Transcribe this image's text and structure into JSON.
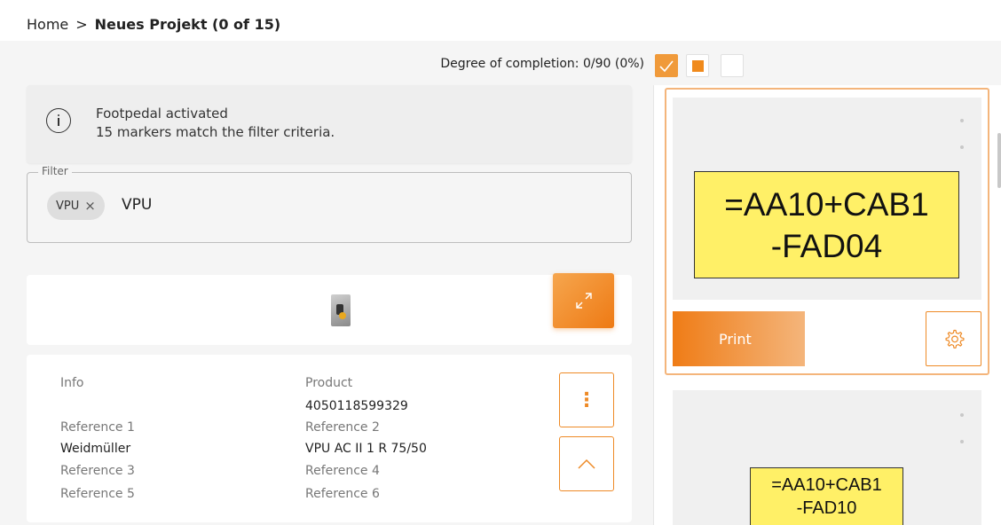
{
  "breadcrumb": {
    "home": "Home",
    "separator": ">",
    "current": "Neues Projekt (0 of 15)"
  },
  "completion": {
    "text": "Degree of completion: 0/90 (0%)"
  },
  "view_buttons": [
    "check-view",
    "square-view",
    "blank-view"
  ],
  "notice": {
    "line1": "Footpedal activated",
    "line2": "15 markers match the filter criteria."
  },
  "filter": {
    "label": "Filter",
    "chip": "VPU",
    "value": "VPU"
  },
  "details": {
    "info_label": "Info",
    "product_label": "Product",
    "product_value": "4050118599329",
    "ref1_label": "Reference 1",
    "ref1_value": "Weidmüller",
    "ref2_label": "Reference 2",
    "ref2_value": "VPU AC II 1 R 75/50",
    "ref3_label": "Reference 3",
    "ref4_label": "Reference 4",
    "ref5_label": "Reference 5",
    "ref6_label": "Reference 6"
  },
  "markers": [
    {
      "line1": "=AA10+CAB1",
      "line2": "-FAD04"
    },
    {
      "line1": "=AA10+CAB1",
      "line2": "-FAD10"
    }
  ],
  "print_label": "Print",
  "colors": {
    "accent": "#ee8a26",
    "label_yellow": "#fff067"
  }
}
